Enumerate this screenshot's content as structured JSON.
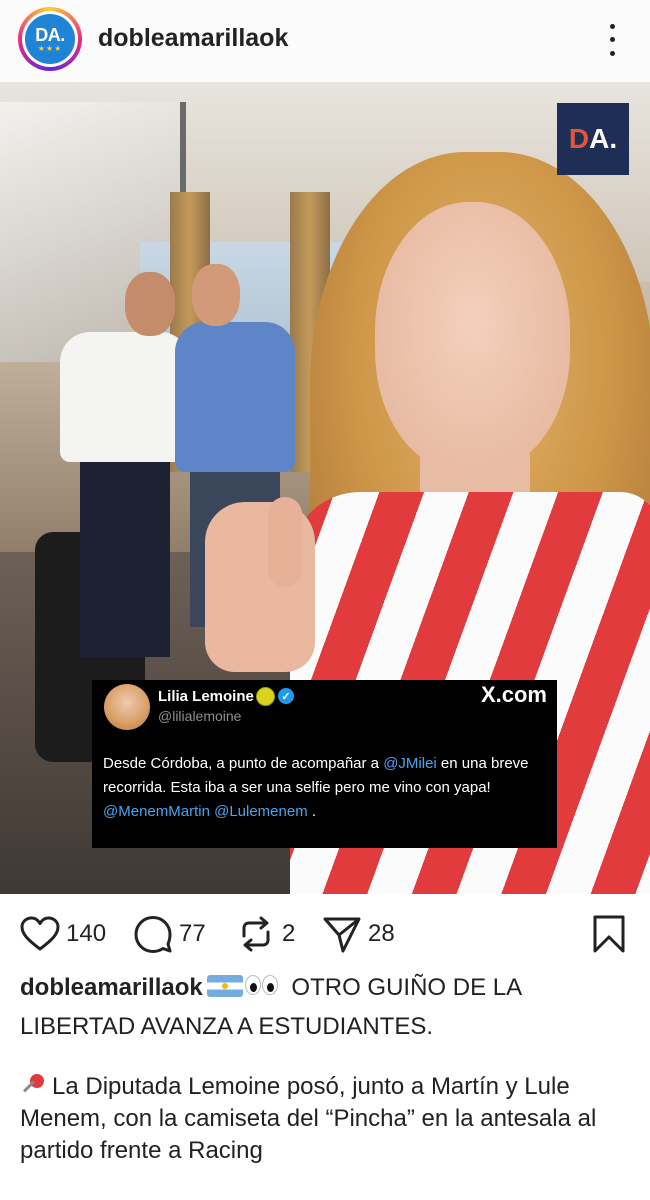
{
  "header": {
    "avatar_text": "DA.",
    "avatar_stars": "★★★",
    "username": "dobleamarillaok",
    "more_icon": "more-vertical-icon"
  },
  "photo": {
    "logo_d": "D",
    "logo_a": "A."
  },
  "tweet": {
    "name": "Lilia Lemoine",
    "handle": "@lilialemoine",
    "brand": "X.com",
    "verified_color": "#1d9bf0",
    "body": {
      "line1_pre": "Desde Córdoba, a punto de acompañar a ",
      "mention1": "@JMilei",
      "line1_post": " en una breve recorrida. Esta iba a ser una selfie pero me vino con yapa! ",
      "mention2": "@MenemMartin",
      "sep": " ",
      "mention3": "@Lulemenem",
      "end": " ."
    }
  },
  "actions": {
    "likes": "140",
    "comments": "77",
    "reposts": "2",
    "shares": "28",
    "icons": [
      "heart-icon",
      "comment-icon",
      "repost-icon",
      "share-icon",
      "bookmark-icon"
    ]
  },
  "caption": {
    "username": "dobleamarillaok",
    "headline": " OTRO GUIÑO DE LA LIBERTAD AVANZA A ESTUDIANTES.",
    "body": "La Diputada Lemoine posó, junto a Martín y Lule Menem, con la camiseta del “Pincha” en la antesala al partido frente a Racing"
  },
  "colors": {
    "mention": "#4aa3ef",
    "jersey_red": "#e23b3e",
    "logo_bg": "#1f2e55"
  }
}
